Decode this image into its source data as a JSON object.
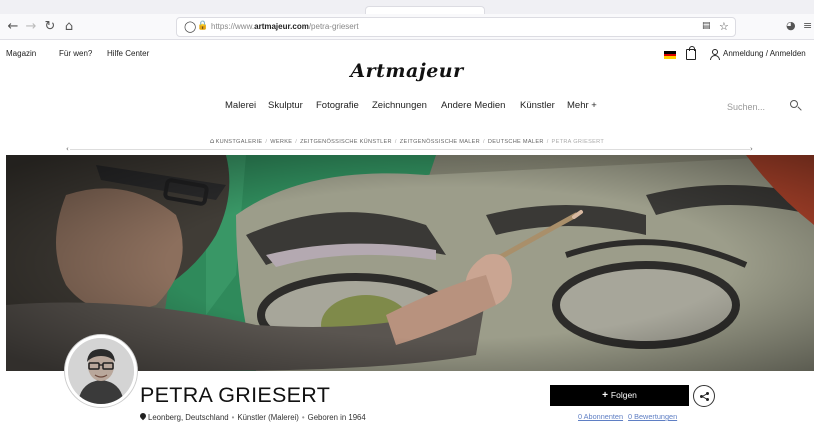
{
  "browser": {
    "url_prefix": "https://www.",
    "url_domain": "artmajeur.com",
    "url_path": "/petra-griesert",
    "nav_icons": [
      "back-arrow",
      "forward-arrow",
      "reload",
      "home"
    ],
    "url_icons": [
      "shield-icon",
      "lock-icon"
    ],
    "right_icons": [
      "reader-view-icon",
      "bookmark-star-icon",
      "pocket-icon",
      "menu-icon"
    ]
  },
  "topbar": {
    "links": [
      "Magazin",
      "Für wen?",
      "Hilfe Center"
    ],
    "auth_label": "Anmeldung / Anmelden",
    "flag_colors": [
      "#000000",
      "#dd0000",
      "#ffce00"
    ]
  },
  "logo": "Artmajeur",
  "mainnav": {
    "items": [
      "Malerei",
      "Skulptur",
      "Fotografie",
      "Zeichnungen",
      "Andere Medien",
      "Künstler",
      "Mehr +"
    ]
  },
  "search": {
    "placeholder": "Suchen..."
  },
  "breadcrumb": {
    "items": [
      "KUNSTGALERIE",
      "WERKE",
      "ZEITGENÖSSISCHE KÜNSTLER",
      "ZEITGENÖSSISCHE MALER",
      "DEUTSCHE MALER"
    ],
    "current": "PETRA GRIESERT",
    "separator": "/"
  },
  "profile": {
    "name": "PETRA GRIESERT",
    "location": "Leonberg, Deutschland",
    "role": "Künstler (Malerei)",
    "born": "Geboren in 1964",
    "follow_label": "Folgen",
    "subscribers": "0 Abonnenten",
    "reviews": "0 Bewertungen"
  },
  "colors": {
    "accent_link": "#5f7fc4",
    "button_bg": "#000000",
    "button_text": "#ffffff"
  }
}
